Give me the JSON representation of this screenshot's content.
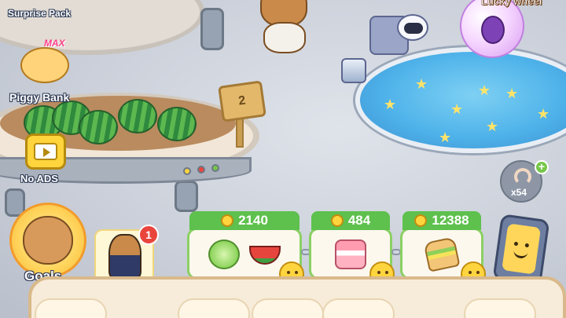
{
  "left_menu": {
    "surprise_pack": {
      "label": "Surprise Pack",
      "icon": "gift-box-icon"
    },
    "piggy_bank": {
      "label": "Piggy Bank",
      "badge": "MAX",
      "icon": "piggy-bank-icon"
    },
    "no_ads": {
      "label": "No ADS",
      "icon": "tv-play-icon"
    }
  },
  "lucky_wheel": {
    "label": "Lucky wheel",
    "icon": "eggplant-icon"
  },
  "farm_sign": {
    "level": "2"
  },
  "worm_counter": {
    "count": "x54",
    "icon": "worm-icon",
    "add_icon": "plus-icon"
  },
  "goals": {
    "label": "Goals",
    "icon": "capybara-icon"
  },
  "worker": {
    "notification_count": "1",
    "icon": "capybara-suit-icon"
  },
  "orders": [
    {
      "price": "2140",
      "items": [
        "lettuce",
        "watermelon"
      ]
    },
    {
      "price": "484",
      "items": [
        "strawberry-cake"
      ]
    },
    {
      "price": "12388",
      "items": [
        "sandwich"
      ]
    }
  ],
  "phone": {
    "icon": "phone-smiley-icon"
  },
  "colors": {
    "order_green": "#5ec04d",
    "badge_red": "#e9453d",
    "coin_gold": "#ffd43d",
    "pond_blue": "#4fb3ea"
  }
}
